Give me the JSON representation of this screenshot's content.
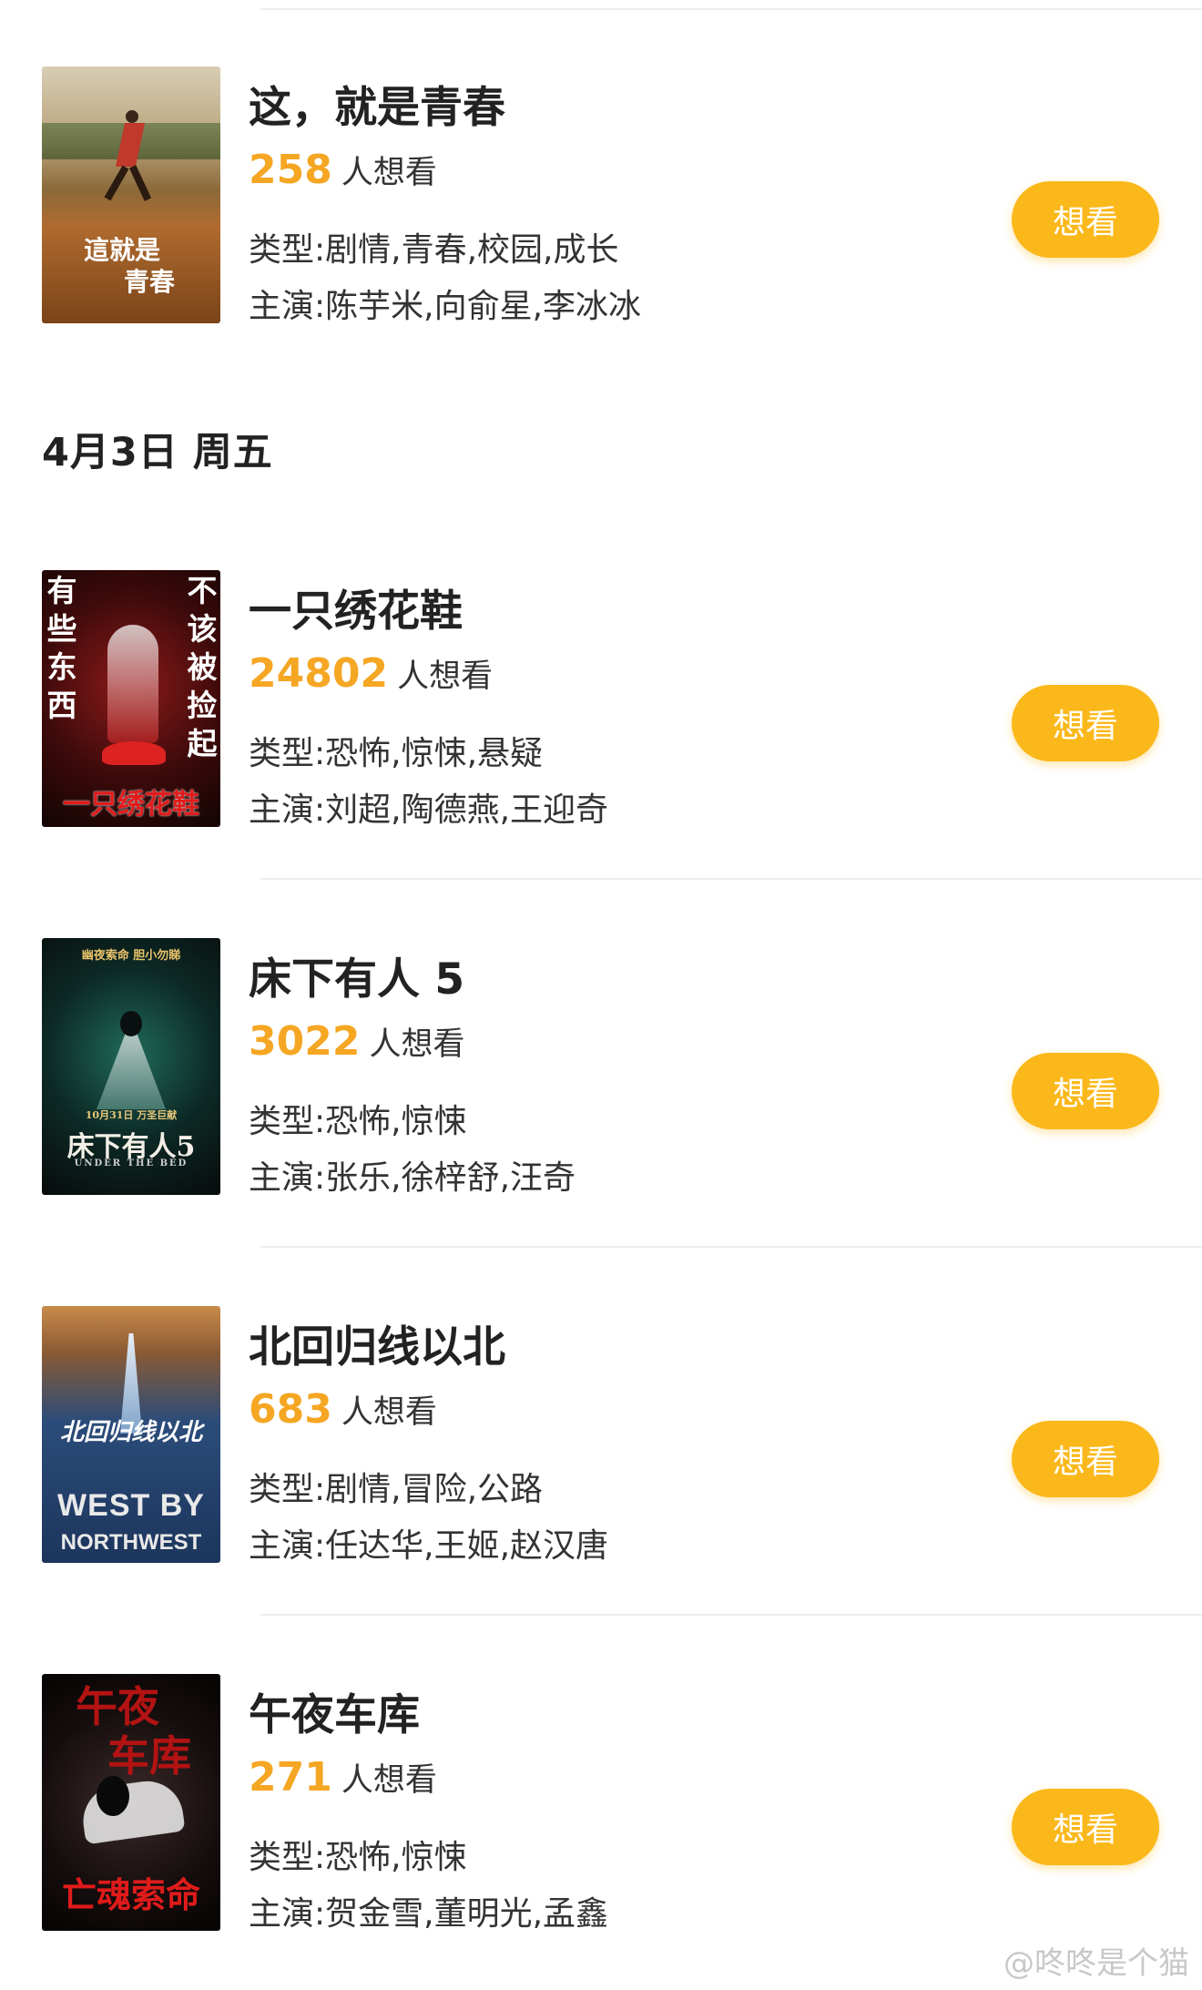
{
  "date_header": "4月3日 周五",
  "want_button_label": "想看",
  "want_suffix": "人想看",
  "movies": [
    {
      "title": "这，就是青春",
      "want_count": "258",
      "genre": "类型:剧情,青春,校园,成长",
      "cast": "主演:陈芋米,向俞星,李冰冰",
      "poster_text": [
        "這就是",
        "青春"
      ]
    },
    {
      "title": "一只绣花鞋",
      "want_count": "24802",
      "genre": "类型:恐怖,惊悚,悬疑",
      "cast": "主演:刘超,陶德燕,王迎奇",
      "poster_text": [
        "有些东西",
        "不该被捡起",
        "一只绣花鞋"
      ]
    },
    {
      "title": "床下有人 5",
      "want_count": "3022",
      "genre": "类型:恐怖,惊悚",
      "cast": "主演:张乐,徐梓舒,汪奇",
      "poster_text": [
        "幽夜索命 胆小勿睇",
        "10月31日 万圣巨献",
        "床下有人5",
        "UNDER THE BED"
      ]
    },
    {
      "title": "北回归线以北",
      "want_count": "683",
      "genre": "类型:剧情,冒险,公路",
      "cast": "主演:任达华,王姬,赵汉唐",
      "poster_text": [
        "北回归线以北",
        "WEST BY",
        "NORTHWEST"
      ]
    },
    {
      "title": "午夜车库",
      "want_count": "271",
      "genre": "类型:恐怖,惊悚",
      "cast": "主演:贺金雪,董明光,孟鑫",
      "poster_text": [
        "午夜",
        "车库",
        "亡魂索命"
      ]
    }
  ],
  "watermark": "@咚咚是个猫"
}
